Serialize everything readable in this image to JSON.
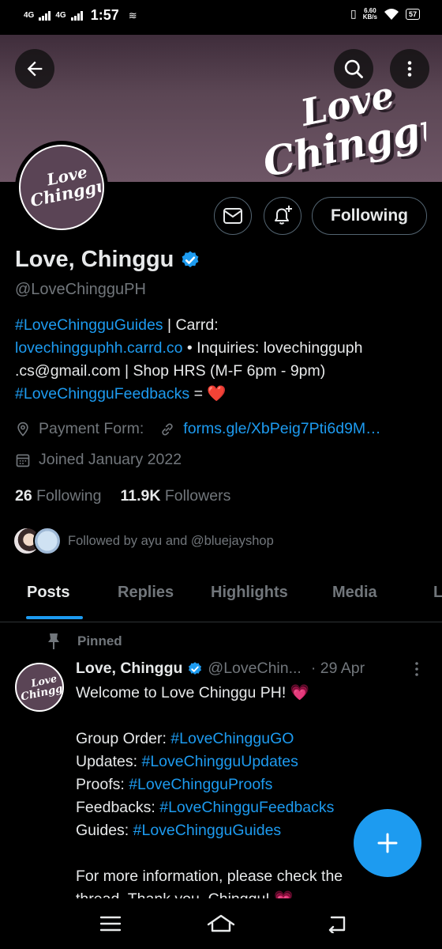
{
  "status_bar": {
    "net1": "4G",
    "net2": "4G",
    "time": "1:57",
    "speed_value": "6.60",
    "speed_unit": "KB/s",
    "battery": "57"
  },
  "banner": {
    "logo_line1": "Love",
    "logo_line2": "Chinggu"
  },
  "avatar": {
    "logo_line1": "Love",
    "logo_line2": "Chinggu"
  },
  "actions": {
    "follow_label": "Following"
  },
  "profile": {
    "name": "Love, Chinggu",
    "handle": "@LoveChingguPH",
    "bio": {
      "tag1": "#LoveChingguGuides",
      "text1": " | Carrd:",
      "link": "lovechingguphh.carrd.co",
      "text2": " • Inquiries: lovechingguph .cs@gmail.com | Shop HRS (M-F 6pm - 9pm)",
      "tag2": "#LoveChingguFeedbacks",
      "text3": " = ❤️"
    },
    "payment_label": "Payment Form:",
    "payment_link": "forms.gle/XbPeig7Pti6d9M…",
    "joined": "Joined January 2022",
    "following_count": "26",
    "following_label": "Following",
    "followers_count": "11.9K",
    "followers_label": "Followers",
    "followed_by": "Followed by ayu and @bluejayshop"
  },
  "tabs": [
    {
      "label": "Posts"
    },
    {
      "label": "Replies"
    },
    {
      "label": "Highlights"
    },
    {
      "label": "Media"
    },
    {
      "label": "L"
    }
  ],
  "tweet": {
    "pinned_label": "Pinned",
    "author": "Love, Chinggu",
    "handle": "@LoveChin...",
    "date": "· 29 Apr",
    "line1": "Welcome to Love Chinggu PH! 💗",
    "rows": [
      {
        "label": "Group Order: ",
        "tag": "#LoveChingguGO"
      },
      {
        "label": "Updates: ",
        "tag": "#LoveChingguUpdates"
      },
      {
        "label": "Proofs: ",
        "tag": "#LoveChingguProofs"
      },
      {
        "label": "Feedbacks: ",
        "tag": "#LoveChingguFeedbacks"
      },
      {
        "label": "Guides: ",
        "tag": "#LoveChingguGuides"
      }
    ],
    "footer1": "For more information, please check the",
    "footer2": "thread. Thank you, Chinggu! 💗"
  },
  "colors": {
    "accent": "#1d9bf0",
    "banner": "#5b4654",
    "heart": "#e0245e"
  }
}
